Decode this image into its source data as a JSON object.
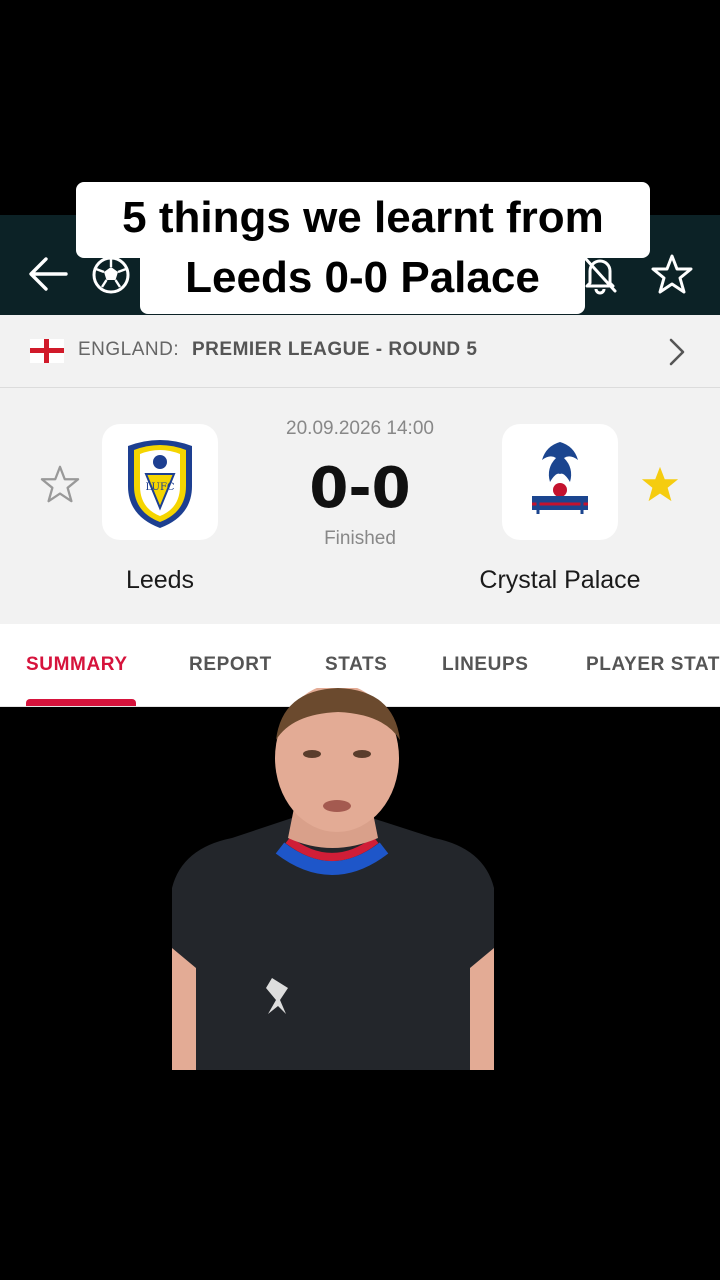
{
  "caption": {
    "line1": "5 things we learnt from",
    "line2": "Leeds 0-0 Palace"
  },
  "topbar": {
    "icons": [
      "back-arrow-icon",
      "football-icon",
      "bell-off-icon",
      "star-outline-icon"
    ]
  },
  "league": {
    "country": "ENGLAND:",
    "competition": "PREMIER LEAGUE - ROUND 5"
  },
  "match": {
    "datetime": "20.09.2026 14:00",
    "score": "0-0",
    "status": "Finished",
    "home": {
      "name": "Leeds",
      "favorite": false
    },
    "away": {
      "name": "Crystal Palace",
      "favorite": true
    }
  },
  "tabs": [
    "SUMMARY",
    "REPORT",
    "STATS",
    "LINEUPS",
    "PLAYER STATS"
  ],
  "active_tab": "SUMMARY",
  "colors": {
    "header_bg": "#0c2226",
    "accent": "#d6133c",
    "favorite_star": "#f5cc10",
    "palace_jersey": "#23262b"
  }
}
